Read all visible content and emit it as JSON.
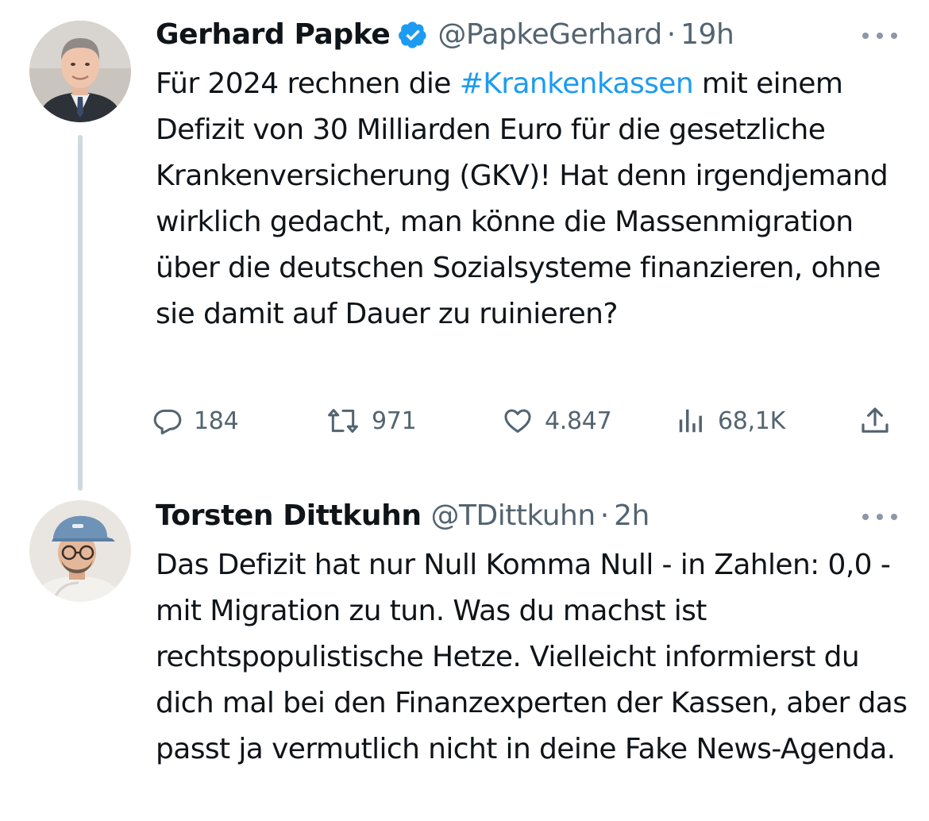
{
  "tweets": [
    {
      "author": {
        "display_name": "Gerhard Papke",
        "handle": "@PapkeGerhard",
        "verified": true,
        "avatar": "portrait-man-suit-grey-hair"
      },
      "separator": "·",
      "time": "19h",
      "text": {
        "before": "Für 2024 rechnen die ",
        "hashtag": "#Krankenkassen",
        "after": " mit einem Defizit von 30 Milliarden Euro für die gesetzliche Krankenversicherung (GKV)! Hat denn irgendjemand wirklich gedacht, man könne die Massenmigration über die deutschen Sozialsysteme finanzieren, ohne sie damit auf Dauer zu ruinieren?"
      },
      "metrics": {
        "replies": "184",
        "retweets": "971",
        "likes": "4.847",
        "views": "68,1K"
      },
      "icons": {
        "reply": "reply-icon",
        "retweet": "retweet-icon",
        "like": "heart-icon",
        "views": "views-bar-chart-icon",
        "share": "share-icon",
        "more": "more-options-icon",
        "verified": "verified-badge-icon"
      }
    },
    {
      "author": {
        "display_name": "Torsten Dittkuhn",
        "handle": "@TDittkuhn",
        "verified": false,
        "avatar": "portrait-man-glasses-blue-cap"
      },
      "separator": "·",
      "time": "2h",
      "text": "Das Defizit hat nur Null Komma Null - in Zahlen: 0,0 - mit Migration zu tun. Was du machst ist rechtspopulistische Hetze. Vielleicht informierst du dich mal bei den Finanzexperten der Kassen, aber das passt ja vermutlich nicht in deine Fake News-Agenda."
    }
  ],
  "colors": {
    "text": "#0f1419",
    "secondary": "#536471",
    "link": "#1d9bf0",
    "thread_line": "#cfd9de",
    "verified": "#1d9bf0"
  }
}
